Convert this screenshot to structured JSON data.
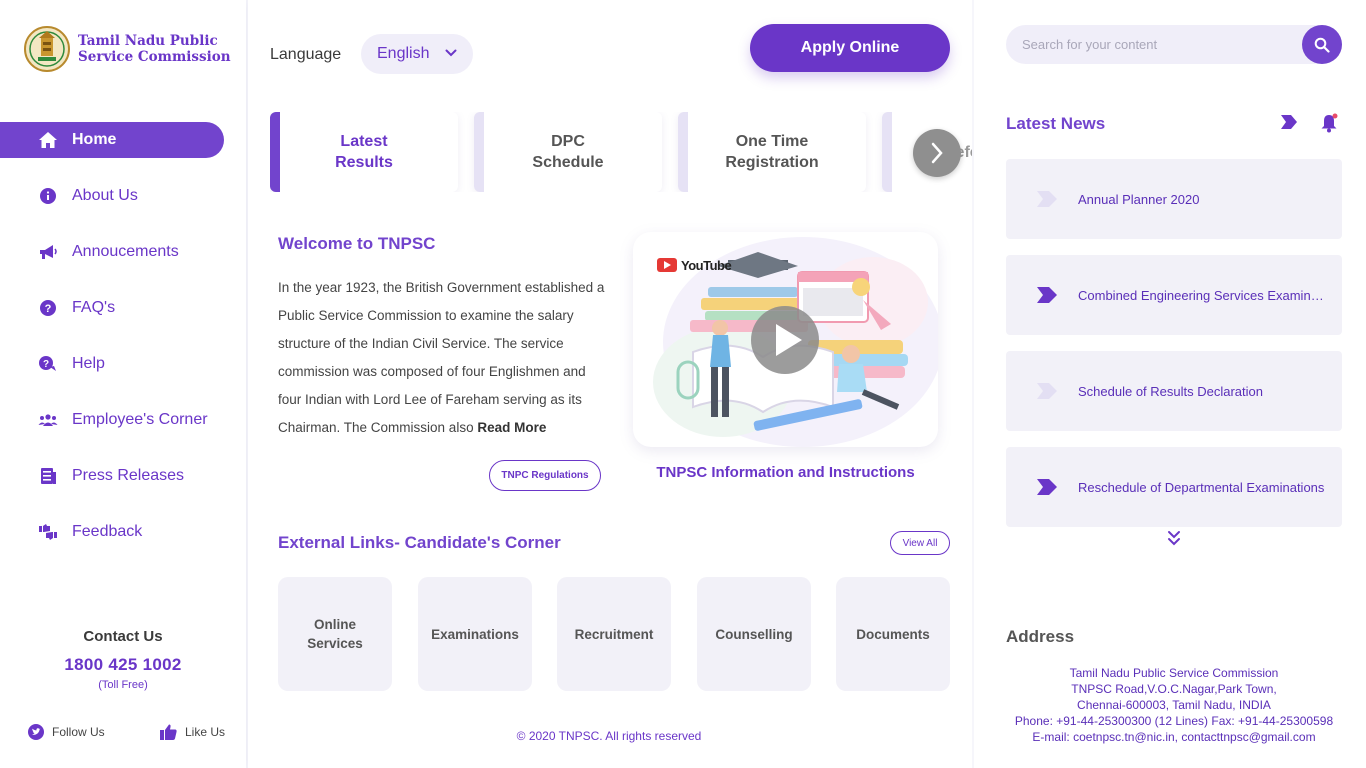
{
  "brand": {
    "line1": "Tamil Nadu Public",
    "line2": "Service Commission",
    "logo": "tamil-nadu-emblem"
  },
  "sidebar": {
    "items": [
      {
        "label": "Home",
        "icon": "home-icon",
        "active": true
      },
      {
        "label": "About Us",
        "icon": "info-icon"
      },
      {
        "label": "Annoucements",
        "icon": "megaphone-icon"
      },
      {
        "label": "FAQ's",
        "icon": "question-icon"
      },
      {
        "label": "Help",
        "icon": "help-chat-icon"
      },
      {
        "label": "Employee's Corner",
        "icon": "people-icon"
      },
      {
        "label": "Press Releases",
        "icon": "newspaper-icon"
      },
      {
        "label": "Feedback",
        "icon": "thumbs-icon"
      }
    ],
    "contact": {
      "title": "Contact Us",
      "phone": "1800 425 1002",
      "toll": "(Toll Free)"
    },
    "social": {
      "follow": "Follow Us",
      "like": "Like Us"
    }
  },
  "header": {
    "language_label": "Language",
    "language_value": "English",
    "apply_label": "Apply Online"
  },
  "tabs": [
    {
      "line1": "Latest",
      "line2": "Results",
      "active": true
    },
    {
      "line1": "DPC",
      "line2": "Schedule"
    },
    {
      "line1": "One Time",
      "line2": "Registration"
    },
    {
      "line1": "Refo",
      "line2": ""
    }
  ],
  "welcome": {
    "title": "Welcome to TNPSC",
    "text": "In the year 1923, the British Government established a Public Service Commission to examine the salary structure of the Indian Civil Service. The service commission was composed of four Englishmen and four Indian with Lord Lee of Fareham serving as its Chairman. The Commission also",
    "read_more": "Read More",
    "regulations_label": "TNPC Regulations"
  },
  "video": {
    "brand": "YouTube",
    "caption": "TNPSC Information and Instructions"
  },
  "external": {
    "title": "External Links- Candidate's Corner",
    "view_all": "View All",
    "cards": [
      {
        "line1": "Online",
        "line2": "Services"
      },
      {
        "line1": "Examinations",
        "line2": ""
      },
      {
        "line1": "Recruitment",
        "line2": ""
      },
      {
        "line1": "Counselling",
        "line2": ""
      },
      {
        "line1": "Documents",
        "line2": ""
      }
    ]
  },
  "footer": {
    "copyright": "© 2020 TNPSC. All rights reserved"
  },
  "right": {
    "search_placeholder": "Search for your content",
    "news_title": "Latest News",
    "news": [
      {
        "text": "Annual Planner 2020",
        "icon_color": "#e3dff3"
      },
      {
        "text": "Combined Engineering Services Examination",
        "icon_color": "#6a36c8"
      },
      {
        "text": "Schedule of Results Declaration",
        "icon_color": "#e3dff3"
      },
      {
        "text": "Reschedule of Departmental Examinations",
        "icon_color": "#6a36c8"
      }
    ],
    "address_title": "Address",
    "address": [
      "Tamil Nadu Public Service Commission",
      "TNPSC Road,V.O.C.Nagar,Park Town,",
      "Chennai-600003, Tamil Nadu, INDIA",
      "Phone: +91-44-25300300 (12 Lines) Fax: +91-44-25300598",
      "E-mail: coetnpsc.tn@nic.in, contacttnpsc@gmail.com"
    ]
  },
  "colors": {
    "accent": "#6a36c8",
    "accent_light": "#7244cd",
    "panel_bg": "#f2f1f8"
  }
}
